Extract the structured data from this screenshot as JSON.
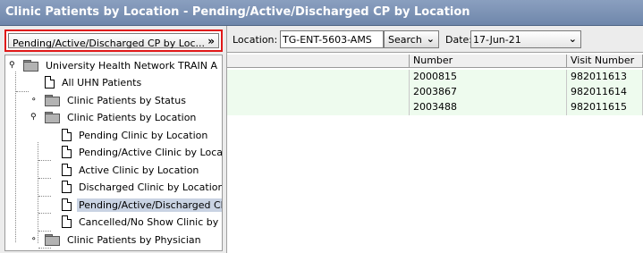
{
  "window": {
    "title": "Clinic Patients by Location - Pending/Active/Discharged CP by Location"
  },
  "view_selector": {
    "selected": "Pending/Active/Discharged CP by Loc...",
    "icon": "chevron-double-down-icon"
  },
  "tree": {
    "root": "University Health Network TRAIN A",
    "items": [
      {
        "label": "All UHN Patients"
      },
      {
        "label": "Clinic Patients by Status"
      },
      {
        "label": "Clinic Patients by Location"
      },
      {
        "label": "Pending Clinic by Location"
      },
      {
        "label": "Pending/Active Clinic by Locat"
      },
      {
        "label": "Active Clinic by Location"
      },
      {
        "label": "Discharged Clinic by Location"
      },
      {
        "label": "Pending/Active/Discharged Cl"
      },
      {
        "label": "Cancelled/No Show Clinic by"
      },
      {
        "label": "Clinic Patients by Physician"
      }
    ]
  },
  "toolbar": {
    "location_label": "Location:",
    "location_value": "TG-ENT-5603-AMS",
    "search_label": "Search",
    "date_label": "Date:",
    "date_value": "17-Jun-21"
  },
  "table": {
    "columns": [
      "",
      "Number",
      "Visit Number"
    ],
    "rows": [
      {
        "number": "2000815",
        "visit": "982011613"
      },
      {
        "number": "2003867",
        "visit": "982011614"
      },
      {
        "number": "2003488",
        "visit": "982011615"
      }
    ],
    "row_color": "#eefbee"
  }
}
